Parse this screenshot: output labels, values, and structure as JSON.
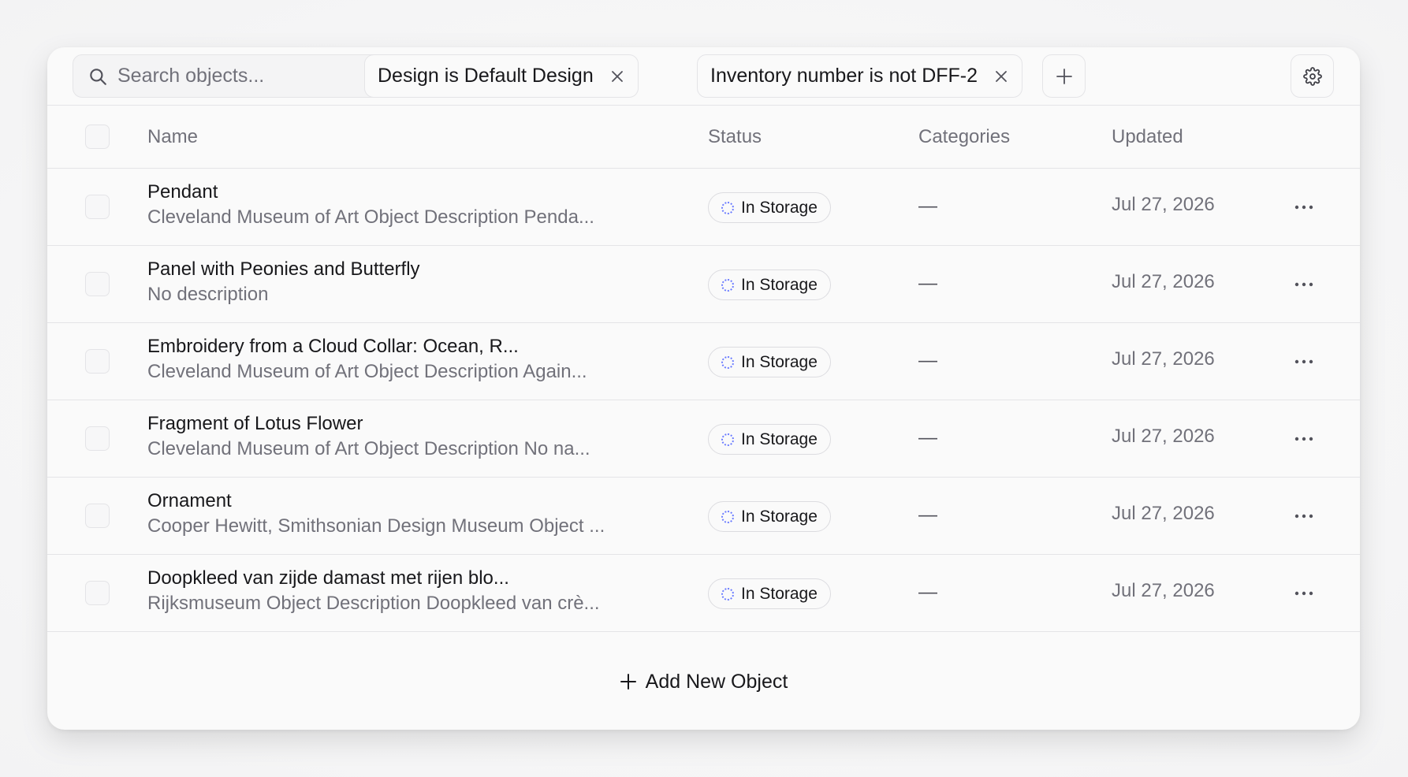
{
  "toolbar": {
    "search_placeholder": "Search objects...",
    "filters": [
      {
        "label": "Design is Default Design"
      },
      {
        "label": "Inventory number is not DFF-2"
      }
    ]
  },
  "table": {
    "columns": {
      "name": "Name",
      "status": "Status",
      "categories": "Categories",
      "updated": "Updated"
    },
    "rows": [
      {
        "name": "Pendant",
        "description": "Cleveland Museum of Art Object Description Penda...",
        "status": "In Storage",
        "categories": "—",
        "updated": "Jul 27, 2026"
      },
      {
        "name": "Panel with Peonies and Butterfly",
        "description": "No description",
        "status": "In Storage",
        "categories": "—",
        "updated": "Jul 27, 2026"
      },
      {
        "name": "Embroidery from a Cloud Collar: Ocean, R...",
        "description": "Cleveland Museum of Art Object Description Again...",
        "status": "In Storage",
        "categories": "—",
        "updated": "Jul 27, 2026"
      },
      {
        "name": "Fragment of Lotus Flower",
        "description": "Cleveland Museum of Art Object Description No na...",
        "status": "In Storage",
        "categories": "—",
        "updated": "Jul 27, 2026"
      },
      {
        "name": "Ornament",
        "description": "Cooper Hewitt, Smithsonian Design Museum Object ...",
        "status": "In Storage",
        "categories": "—",
        "updated": "Jul 27, 2026"
      },
      {
        "name": "Doopkleed van zijde damast met rijen blo...",
        "description": "Rijksmuseum Object Description Doopkleed van crè...",
        "status": "In Storage",
        "categories": "—",
        "updated": "Jul 27, 2026"
      }
    ]
  },
  "footer": {
    "add_label": "Add New Object"
  },
  "icons": {
    "search": "search-icon",
    "close": "close-icon",
    "plus": "plus-icon",
    "settings": "gear-icon",
    "status": "dotted-circle-icon",
    "more": "more-horizontal-icon"
  },
  "colors": {
    "status_ring": "#6b7cff",
    "border": "#e4e4e7",
    "muted_text": "#71717a"
  }
}
